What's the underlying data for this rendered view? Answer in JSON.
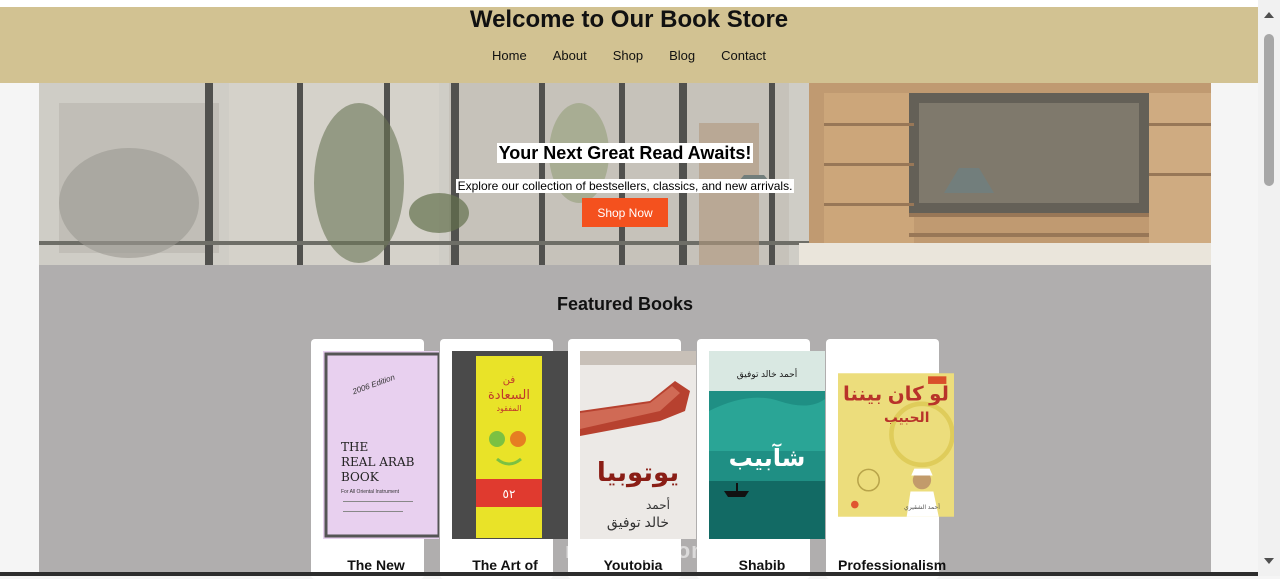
{
  "header": {
    "title": "Welcome to Our Book Store",
    "nav": [
      "Home",
      "About",
      "Shop",
      "Blog",
      "Contact"
    ]
  },
  "hero": {
    "title": "Your Next Great Read Awaits!",
    "subtitle": "Explore our collection of bestsellers, classics, and new arrivals.",
    "button": "Shop Now"
  },
  "featured": {
    "heading": "Featured Books",
    "books": [
      {
        "title": "The New",
        "cover_lines": [
          "2006 Edition",
          "THE",
          "REAL ARAB",
          "BOOK",
          "For All Oriental Instrument"
        ]
      },
      {
        "title": "The Art of",
        "cover_lines": [
          "فن",
          "السعادة",
          "المفقود",
          "٥٢"
        ]
      },
      {
        "title": "Youtobia",
        "cover_lines": [
          "يوتوبيا",
          "أحمد",
          "خالد توفيق"
        ]
      },
      {
        "title": "Shabib",
        "cover_lines": [
          "أحمد خالد توفيق",
          "شآبيب"
        ]
      },
      {
        "title": "Professionalism",
        "cover_lines": [
          "لو كان بيننا",
          "الحبيب",
          "أحمد الشقيري"
        ]
      }
    ]
  },
  "watermark": "mostaql.com",
  "colors": {
    "header_bg": "#d2c292",
    "button": "#f4511e",
    "featured_bg": "#b0aeae"
  }
}
